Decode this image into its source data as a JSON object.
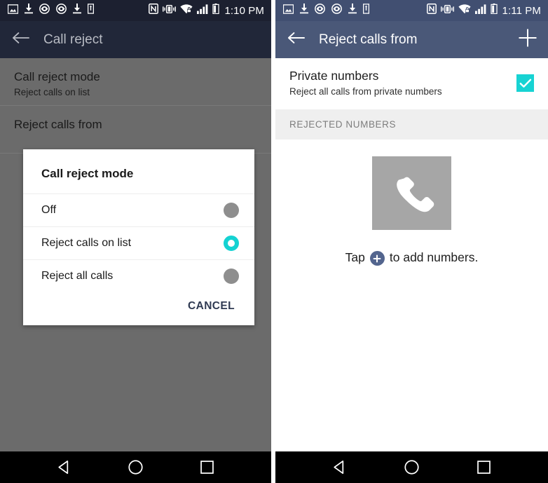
{
  "left_screen": {
    "status_bar": {
      "time": "1:10 PM",
      "left_icons": [
        "image-icon",
        "download-icon",
        "eye-circle-icon",
        "eye-circle-icon",
        "download-icon",
        "usb-icon"
      ],
      "right_icons": [
        "nfc-icon",
        "vibrate-icon",
        "wifi-secure-icon",
        "signal-bars-icon",
        "battery-icon"
      ]
    },
    "app_bar": {
      "back_icon": "back-arrow-icon",
      "title": "Call reject"
    },
    "preferences": [
      {
        "title": "Call reject mode",
        "summary": "Reject calls on list"
      },
      {
        "title": "Reject calls from",
        "summary": ""
      }
    ],
    "dialog": {
      "title": "Call reject mode",
      "options": [
        {
          "label": "Off",
          "selected": false
        },
        {
          "label": "Reject calls on list",
          "selected": true
        },
        {
          "label": "Reject all calls",
          "selected": false
        }
      ],
      "cancel_label": "CANCEL"
    },
    "nav_bar": {
      "back": "back-triangle-icon",
      "home": "home-circle-icon",
      "recents": "recents-square-icon"
    }
  },
  "right_screen": {
    "status_bar": {
      "time": "1:11 PM",
      "left_icons": [
        "image-icon",
        "download-icon",
        "eye-circle-icon",
        "eye-circle-icon",
        "download-icon",
        "usb-icon"
      ],
      "right_icons": [
        "nfc-icon",
        "vibrate-icon",
        "wifi-secure-icon",
        "signal-bars-icon",
        "battery-icon"
      ]
    },
    "app_bar": {
      "back_icon": "back-arrow-icon",
      "title": "Reject calls from",
      "action_icon": "plus-icon"
    },
    "private_numbers": {
      "title": "Private numbers",
      "summary": "Reject all calls from private numbers",
      "checked": true
    },
    "section_header": "REJECTED NUMBERS",
    "empty_state": {
      "icon": "phone-handset-icon",
      "text_before": "Tap",
      "badge_icon": "plus-circle-icon",
      "text_after": "to add numbers."
    },
    "nav_bar": {
      "back": "back-triangle-icon",
      "home": "home-circle-icon",
      "recents": "recents-square-icon"
    }
  },
  "colors": {
    "app_bar_right": "#4a5878",
    "status_bar_right": "#414f71",
    "app_bar_left_dimmed": "#212739",
    "accent_cyan": "#17d3d3",
    "scrim_gray": "#6b6b6b",
    "section_header_bg": "#efefef",
    "empty_icon_bg": "#a6a6a6",
    "plus_badge": "#53658e",
    "nav_bar": "#000000"
  }
}
